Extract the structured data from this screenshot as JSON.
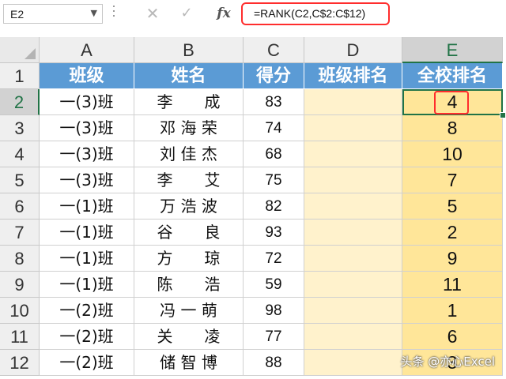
{
  "formula_bar": {
    "cell_ref": "E2",
    "formula": "=RANK(C2,C$2:C$12)",
    "fx_label": "fx"
  },
  "columns": [
    "A",
    "B",
    "C",
    "D",
    "E"
  ],
  "rows": [
    "1",
    "2",
    "3",
    "4",
    "5",
    "6",
    "7",
    "8",
    "9",
    "10",
    "11",
    "12"
  ],
  "table": {
    "headers": [
      "班级",
      "姓名",
      "得分",
      "班级排名",
      "全校排名"
    ],
    "data": [
      {
        "class": "一(3)班",
        "name": "李　　成",
        "score": "83",
        "class_rank": "",
        "school_rank": "4"
      },
      {
        "class": "一(3)班",
        "name": "邓 海 荣",
        "score": "74",
        "class_rank": "",
        "school_rank": "8"
      },
      {
        "class": "一(3)班",
        "name": "刘 佳 杰",
        "score": "68",
        "class_rank": "",
        "school_rank": "10"
      },
      {
        "class": "一(3)班",
        "name": "李　　艾",
        "score": "75",
        "class_rank": "",
        "school_rank": "7"
      },
      {
        "class": "一(1)班",
        "name": "万 浩 波",
        "score": "82",
        "class_rank": "",
        "school_rank": "5"
      },
      {
        "class": "一(1)班",
        "name": "谷　　良",
        "score": "93",
        "class_rank": "",
        "school_rank": "2"
      },
      {
        "class": "一(1)班",
        "name": "方　　琼",
        "score": "72",
        "class_rank": "",
        "school_rank": "9"
      },
      {
        "class": "一(1)班",
        "name": "陈　　浩",
        "score": "59",
        "class_rank": "",
        "school_rank": "11"
      },
      {
        "class": "一(2)班",
        "name": "冯 一 萌",
        "score": "98",
        "class_rank": "",
        "school_rank": "1"
      },
      {
        "class": "一(2)班",
        "name": "关　　凌",
        "score": "77",
        "class_rank": "",
        "school_rank": "6"
      },
      {
        "class": "一(2)班",
        "name": "储 智 博",
        "score": "88",
        "class_rank": "",
        "school_rank": "3"
      }
    ]
  },
  "watermark": "头条 @亦心Excel",
  "colors": {
    "header_fill": "#5b9bd5",
    "class_rank_fill": "#fff2cc",
    "school_rank_fill": "#ffe699",
    "selection": "#217346",
    "highlight": "#ff2d2d"
  }
}
